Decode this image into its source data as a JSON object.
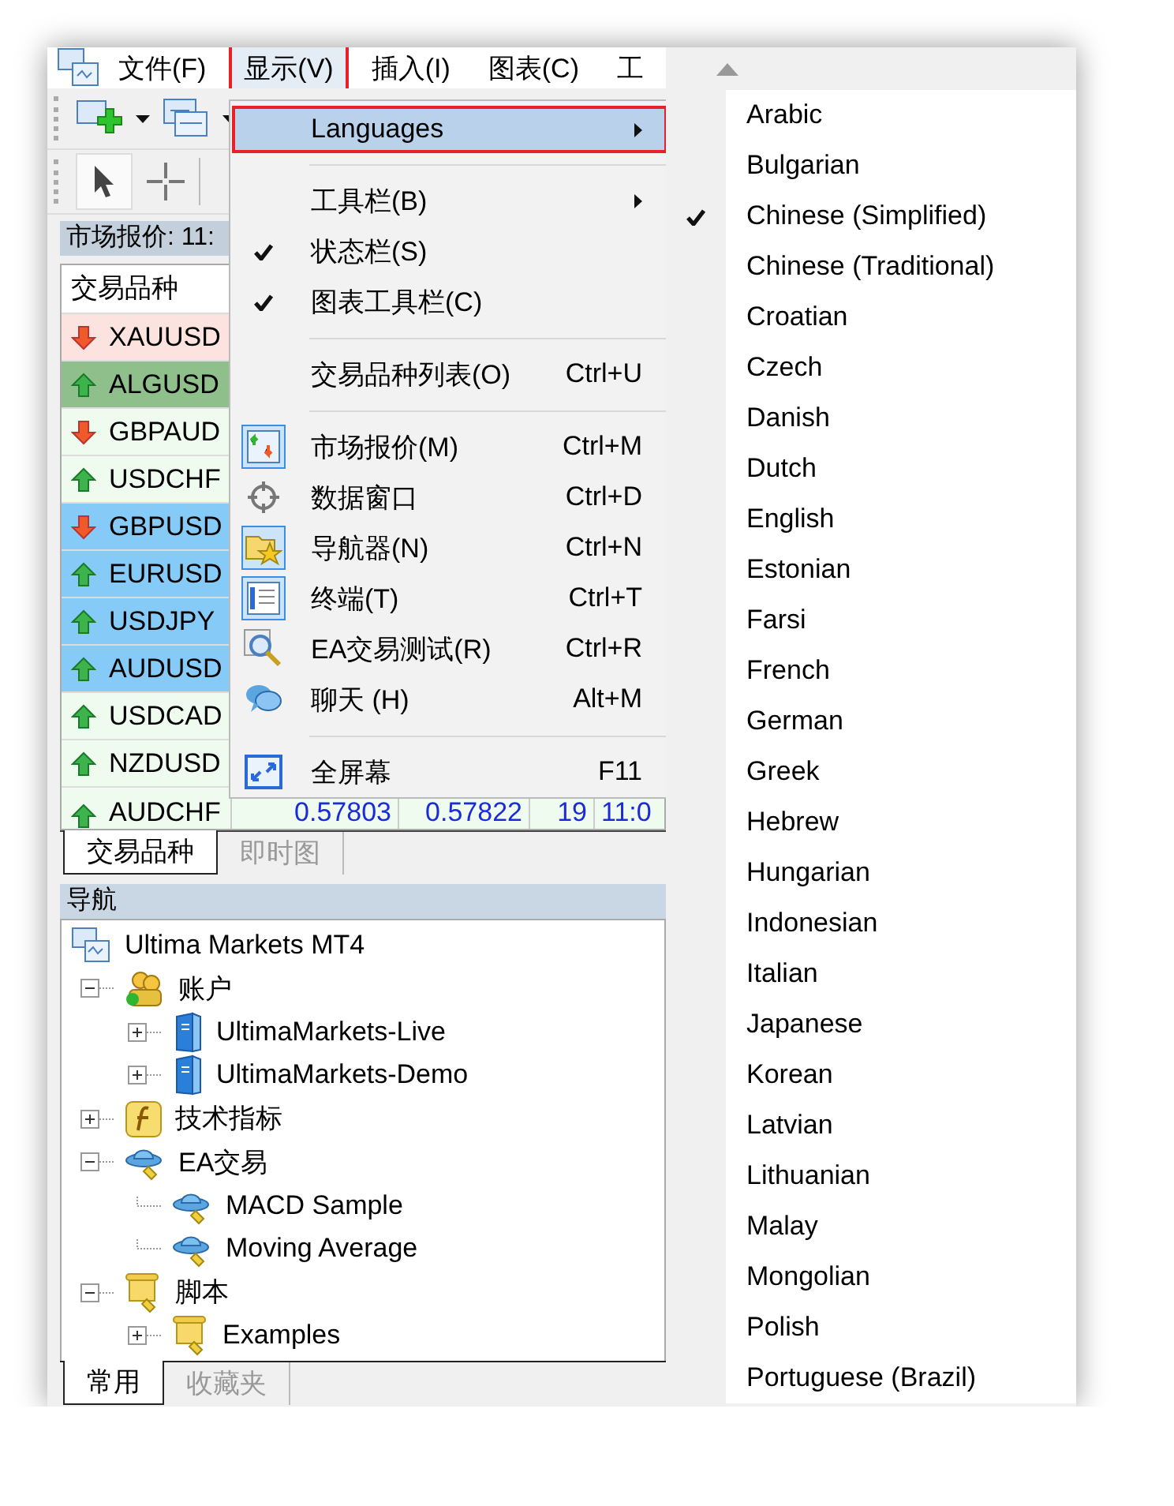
{
  "menubar": {
    "items": [
      {
        "label": "文件(F)",
        "selected": false,
        "outlined": false
      },
      {
        "label": "显示(V)",
        "selected": true,
        "outlined": true
      },
      {
        "label": "插入(I)",
        "selected": false,
        "outlined": false
      },
      {
        "label": "图表(C)",
        "selected": false,
        "outlined": false
      },
      {
        "label": "工",
        "selected": false,
        "outlined": false
      }
    ]
  },
  "market_watch": {
    "title": "市场报价: 11:",
    "column": "交易品种",
    "rows": [
      {
        "symbol": "XAUUSD",
        "rising": false,
        "color": "#fde3df"
      },
      {
        "symbol": "ALGUSD",
        "rising": true,
        "color": "#8fbf8a"
      },
      {
        "symbol": "GBPAUD",
        "rising": false,
        "color": "#f0fbf0"
      },
      {
        "symbol": "USDCHF",
        "rising": true,
        "color": "#f0fbf0"
      },
      {
        "symbol": "GBPUSD",
        "rising": false,
        "color": "#86cbf7"
      },
      {
        "symbol": "EURUSD",
        "rising": true,
        "color": "#86cbf7"
      },
      {
        "symbol": "USDJPY",
        "rising": true,
        "color": "#86cbf7"
      },
      {
        "symbol": "AUDUSD",
        "rising": true,
        "color": "#86cbf7"
      },
      {
        "symbol": "USDCAD",
        "rising": true,
        "color": "#f0fbf0"
      },
      {
        "symbol": "NZDUSD",
        "rising": true,
        "color": "#f0fbf0"
      },
      {
        "symbol": "AUDCHF",
        "rising": true,
        "color": "#f0fbf0",
        "bid": "0.57803",
        "ask": "0.57822",
        "spread": "19",
        "time": "11:0"
      }
    ],
    "tabs": [
      {
        "label": "交易品种",
        "selected": true
      },
      {
        "label": "即时图",
        "selected": false
      }
    ]
  },
  "navigator": {
    "title": "导航",
    "tree": [
      {
        "label": "Ultima Markets MT4",
        "kind": "terminal",
        "children": [
          {
            "label": "账户",
            "kind": "accounts",
            "expanded": true,
            "children": [
              {
                "label": "UltimaMarkets-Live",
                "kind": "server",
                "expanded": false
              },
              {
                "label": "UltimaMarkets-Demo",
                "kind": "server",
                "expanded": false
              }
            ]
          },
          {
            "label": "技术指标",
            "kind": "indicators",
            "expanded": false
          },
          {
            "label": "EA交易",
            "kind": "expert",
            "expanded": true,
            "children": [
              {
                "label": "MACD Sample",
                "kind": "expert"
              },
              {
                "label": "Moving Average",
                "kind": "expert"
              }
            ]
          },
          {
            "label": "脚本",
            "kind": "script",
            "expanded": true,
            "children": [
              {
                "label": "Examples",
                "kind": "script",
                "expanded": false
              }
            ]
          }
        ]
      }
    ],
    "tabs": [
      {
        "label": "常用",
        "selected": true
      },
      {
        "label": "收藏夹",
        "selected": false
      }
    ]
  },
  "view_menu": {
    "items": [
      {
        "kind": "item",
        "label": "Languages",
        "submenu": true,
        "selected": true,
        "outlined": true
      },
      {
        "kind": "separator"
      },
      {
        "kind": "item",
        "label": "工具栏(B)",
        "submenu": true,
        "selected": false
      },
      {
        "kind": "item",
        "label": "状态栏(S)",
        "checked": true,
        "selected": false
      },
      {
        "kind": "item",
        "label": "图表工具栏(C)",
        "checked": true,
        "selected": false
      },
      {
        "kind": "separator"
      },
      {
        "kind": "item",
        "label": "交易品种列表(O)",
        "shortcut": "Ctrl+U",
        "selected": false
      },
      {
        "kind": "separator"
      },
      {
        "kind": "item",
        "label": "市场报价(M)",
        "shortcut": "Ctrl+M",
        "active": true,
        "selected": false
      },
      {
        "kind": "item",
        "label": "数据窗口",
        "shortcut": "Ctrl+D",
        "active": false,
        "selected": false
      },
      {
        "kind": "item",
        "label": "导航器(N)",
        "shortcut": "Ctrl+N",
        "active": true,
        "selected": false
      },
      {
        "kind": "item",
        "label": "终端(T)",
        "shortcut": "Ctrl+T",
        "active": true,
        "selected": false
      },
      {
        "kind": "item",
        "label": "EA交易测试(R)",
        "shortcut": "Ctrl+R",
        "active": false,
        "selected": false
      },
      {
        "kind": "item",
        "label": "聊天 (H)",
        "shortcut": "Alt+M",
        "active": false,
        "selected": false
      },
      {
        "kind": "separator"
      },
      {
        "kind": "item",
        "label": "全屏幕",
        "shortcut": "F11",
        "active": false,
        "selected": false
      }
    ]
  },
  "languages_menu": {
    "items": [
      {
        "label": "Arabic",
        "checked": false
      },
      {
        "label": "Bulgarian",
        "checked": false
      },
      {
        "label": "Chinese (Simplified)",
        "checked": true
      },
      {
        "label": "Chinese (Traditional)",
        "checked": false
      },
      {
        "label": "Croatian",
        "checked": false
      },
      {
        "label": "Czech",
        "checked": false
      },
      {
        "label": "Danish",
        "checked": false
      },
      {
        "label": "Dutch",
        "checked": false
      },
      {
        "label": "English",
        "checked": false
      },
      {
        "label": "Estonian",
        "checked": false
      },
      {
        "label": "Farsi",
        "checked": false
      },
      {
        "label": "French",
        "checked": false
      },
      {
        "label": "German",
        "checked": false
      },
      {
        "label": "Greek",
        "checked": false
      },
      {
        "label": "Hebrew",
        "checked": false
      },
      {
        "label": "Hungarian",
        "checked": false
      },
      {
        "label": "Indonesian",
        "checked": false
      },
      {
        "label": "Italian",
        "checked": false
      },
      {
        "label": "Japanese",
        "checked": false
      },
      {
        "label": "Korean",
        "checked": false
      },
      {
        "label": "Latvian",
        "checked": false
      },
      {
        "label": "Lithuanian",
        "checked": false
      },
      {
        "label": "Malay",
        "checked": false
      },
      {
        "label": "Mongolian",
        "checked": false
      },
      {
        "label": "Polish",
        "checked": false
      },
      {
        "label": "Portuguese (Brazil)",
        "checked": false
      }
    ]
  }
}
